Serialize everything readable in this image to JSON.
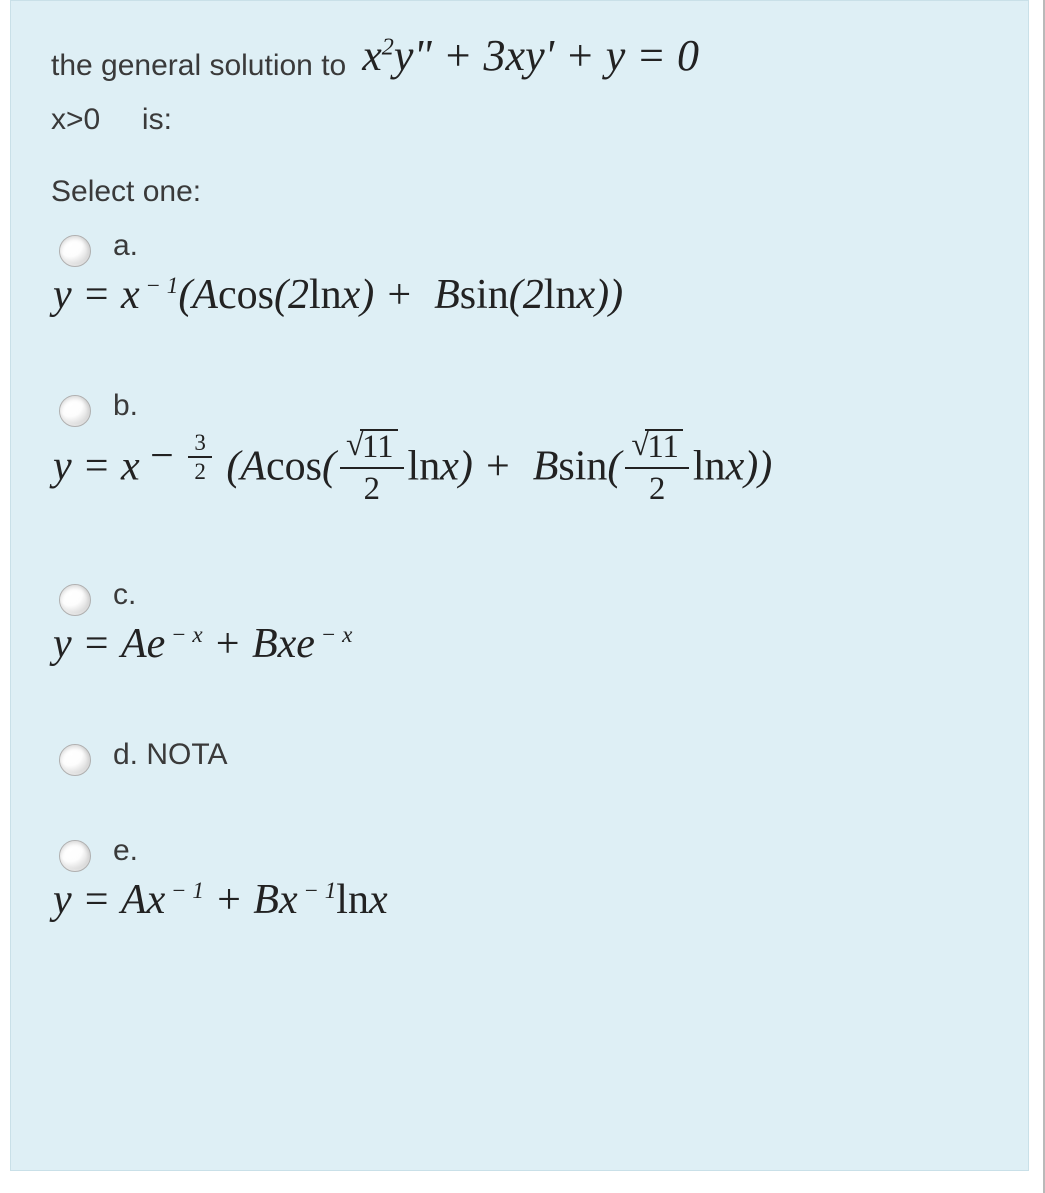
{
  "question": {
    "intro_text": "the general solution to",
    "equation_text": "x²y\" + 3xy' + y = 0",
    "condition_text": "x>0",
    "condition_suffix": "is:"
  },
  "prompt": "Select one:",
  "options": {
    "a": {
      "letter": "a.",
      "formula_text": "y = x⁻¹(Acos(2lnx) + Bsin(2lnx))"
    },
    "b": {
      "letter": "b.",
      "formula_text": "y = x^(−3/2) (Acos((√11/2) lnx) + Bsin((√11/2) lnx))"
    },
    "c": {
      "letter": "c.",
      "formula_text": "y = Ae⁻ˣ + Bxe⁻ˣ"
    },
    "d": {
      "letter": "d. NOTA",
      "formula_text": ""
    },
    "e": {
      "letter": "e.",
      "formula_text": "y = Ax⁻¹ + Bx⁻¹lnx"
    }
  }
}
